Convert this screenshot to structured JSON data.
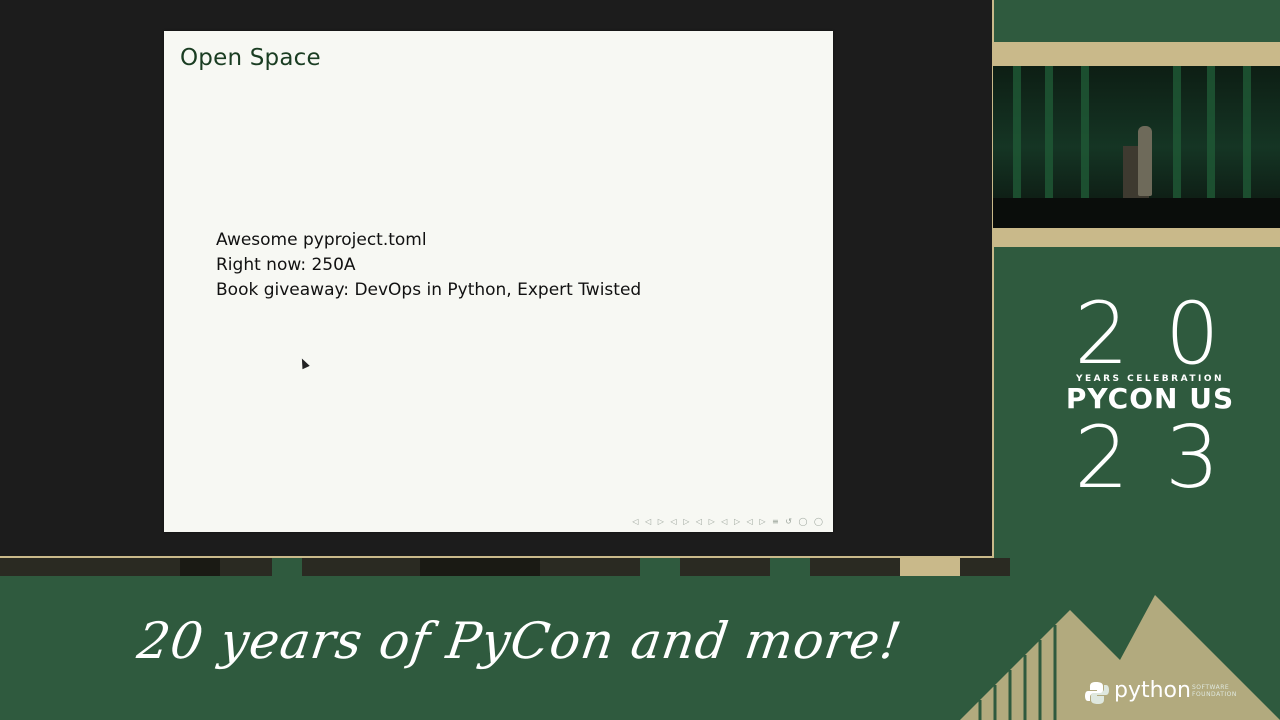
{
  "slide": {
    "title": "Open Space",
    "lines": [
      "Awesome pyproject.toml",
      "Right now: 250A",
      "Book giveaway: DevOps in Python, Expert Twisted"
    ],
    "nav_controls": "◁ ◁ ▷ ◁ ▷ ◁ ▷ ◁ ▷   ◁ ▷   ≡   ↺ ◯ ◯"
  },
  "branding": {
    "year_top": "20",
    "subtitle": "YEARS CELEBRATION",
    "main": "PYCON US",
    "year_bottom": "23",
    "tagline": "20 years of PyCon and more!",
    "python_word": "python",
    "psf_text": "SOFTWARE\nFOUNDATION"
  },
  "colors": {
    "background": "#2f5a3e",
    "accent_gold": "#c9b98a",
    "slide_bg": "#f7f8f3"
  }
}
